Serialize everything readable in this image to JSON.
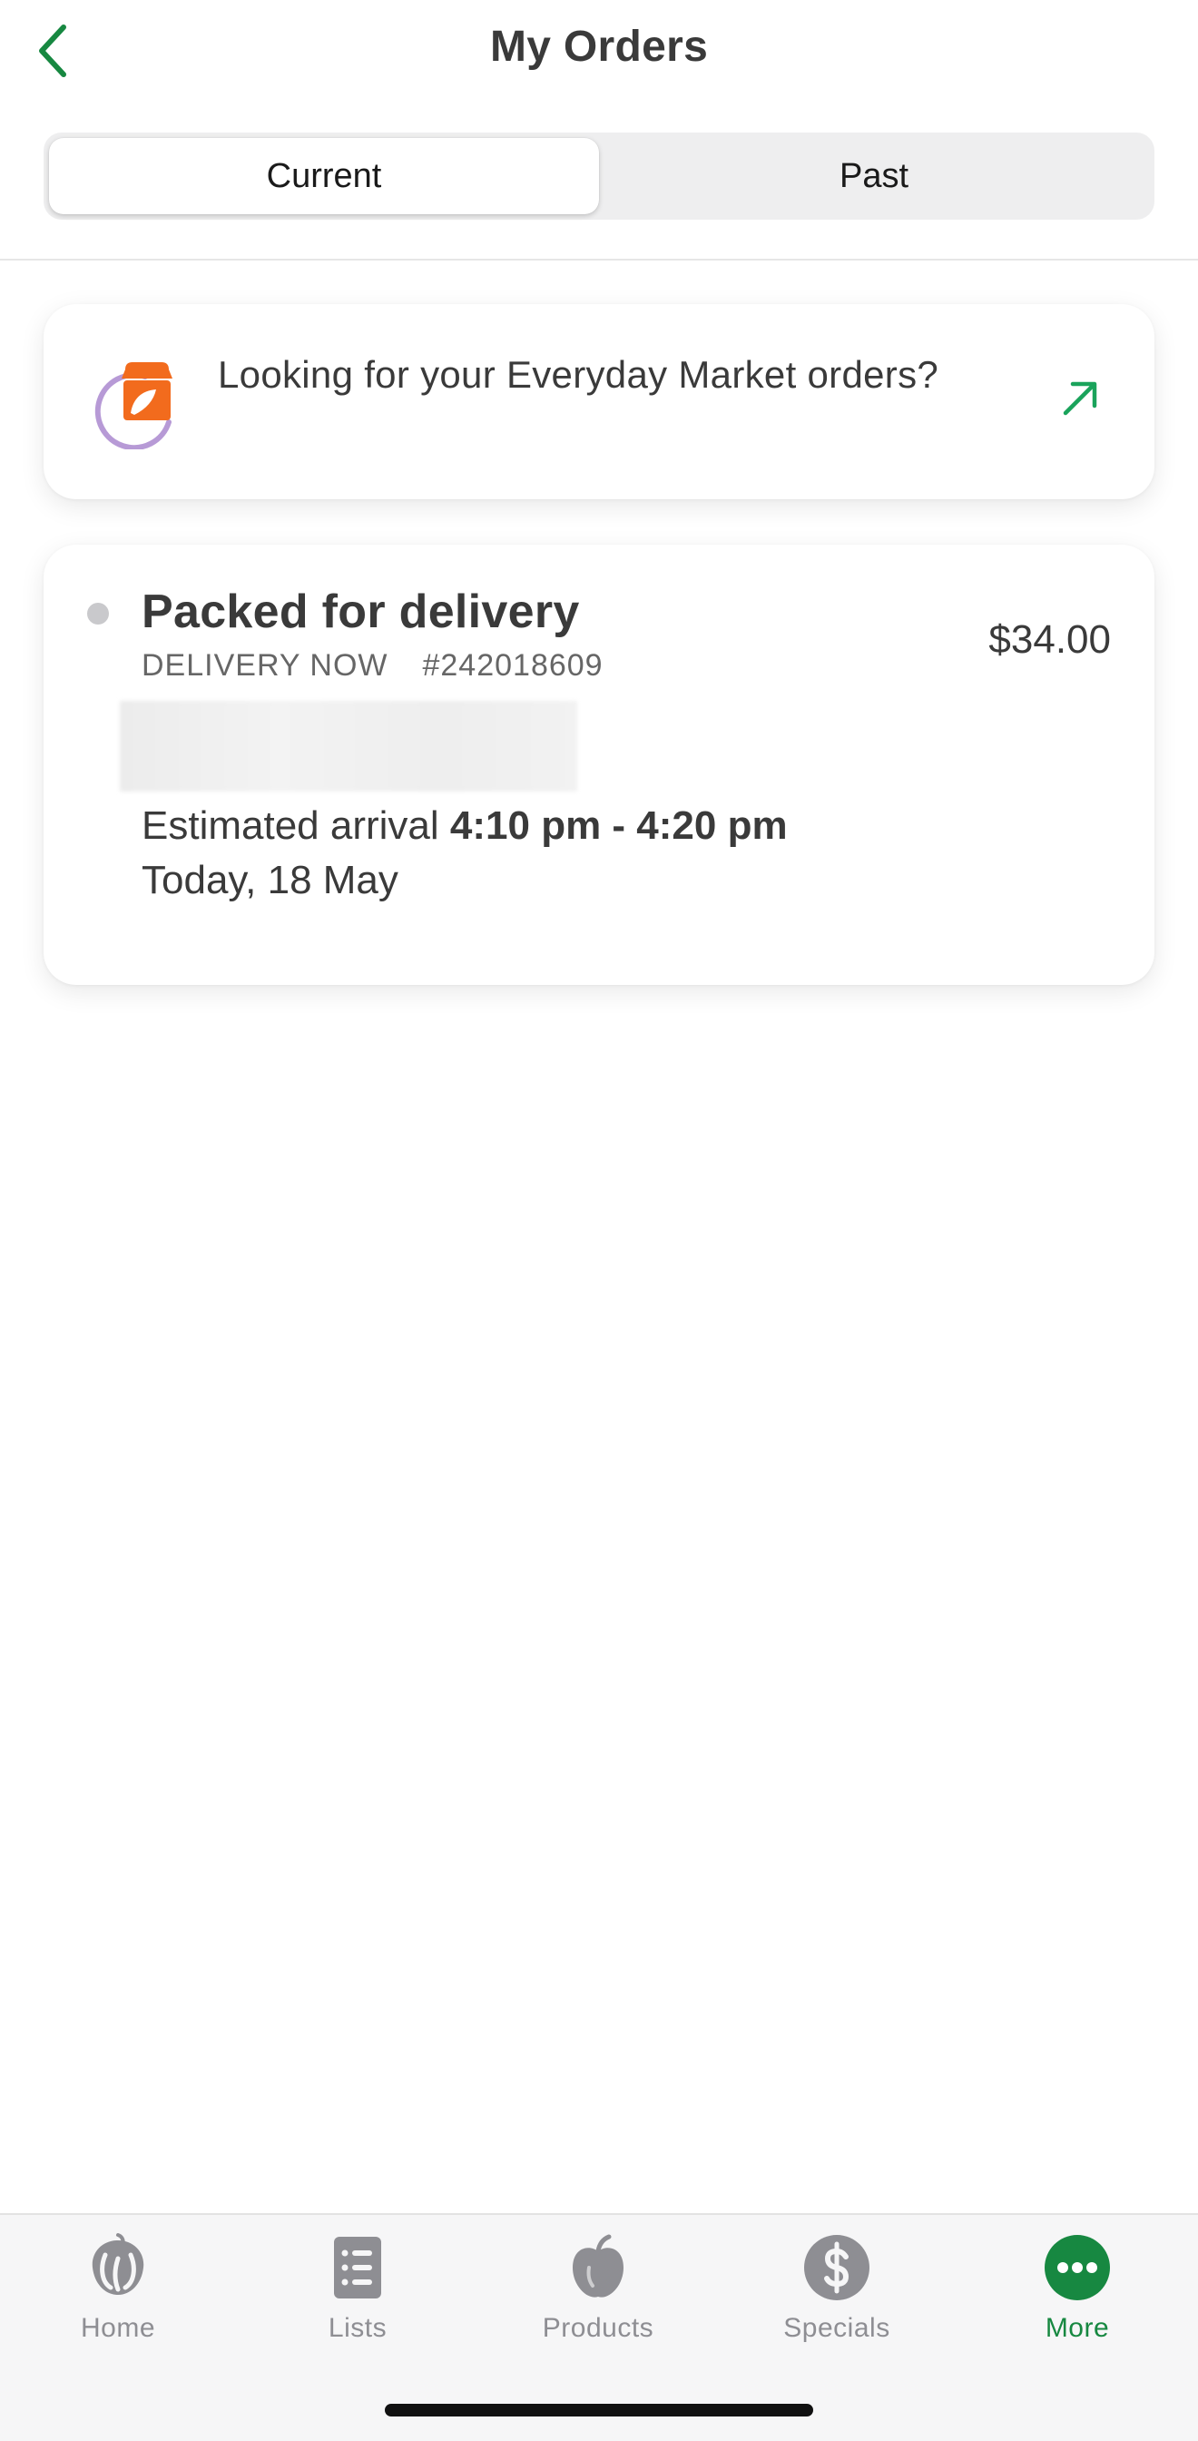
{
  "header": {
    "title": "My Orders",
    "back_icon": "chevron-left-icon"
  },
  "segmented": {
    "current_label": "Current",
    "past_label": "Past",
    "selected": "Current"
  },
  "promo": {
    "text": "Looking for your Everyday Market orders?",
    "logo_icon": "everyday-market-logo-icon",
    "arrow_icon": "arrow-up-right-icon"
  },
  "order": {
    "status": "Packed for delivery",
    "delivery_type": "DELIVERY NOW",
    "order_number": "#242018609",
    "price": "$34.00",
    "arrival_prefix": "Estimated arrival",
    "arrival_window": "4:10 pm - 4:20 pm",
    "arrival_date": "Today, 18 May"
  },
  "tabbar": {
    "items": [
      {
        "label": "Home",
        "icon": "woolworths-logo-icon"
      },
      {
        "label": "Lists",
        "icon": "list-icon"
      },
      {
        "label": "Products",
        "icon": "apple-icon"
      },
      {
        "label": "Specials",
        "icon": "dollar-icon"
      },
      {
        "label": "More",
        "icon": "more-icon"
      }
    ],
    "active": "More"
  },
  "colors": {
    "brand_green": "#178841",
    "promo_orange": "#f26b1d",
    "promo_purple": "#b79ad6",
    "arrow_green": "#1aa35b",
    "inactive_grey": "#8e8e93"
  }
}
